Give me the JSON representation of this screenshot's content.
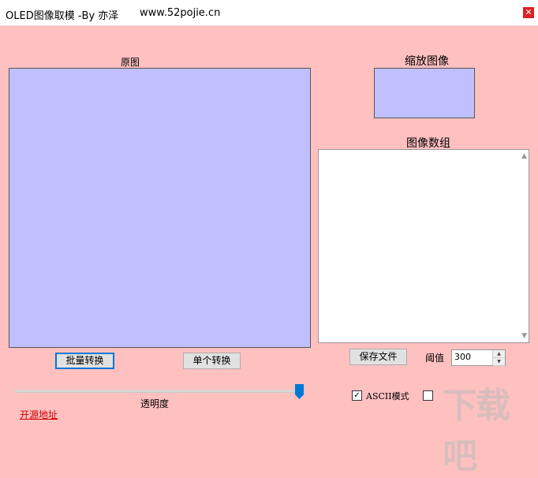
{
  "window": {
    "title": "OLED图像取模   -By 亦泽",
    "site": "www.52pojie.cn",
    "close_glyph": "✕"
  },
  "labels": {
    "original": "原图",
    "scaled": "缩放图像",
    "array": "图像数组",
    "transparency": "透明度",
    "threshold": "阈值"
  },
  "buttons": {
    "batch": "批量转换",
    "single": "单个转换",
    "save": "保存文件"
  },
  "threshold": {
    "value": "300"
  },
  "slider": {
    "value_fraction": 0.98
  },
  "ascii": {
    "label": "ASCII模式",
    "checked": true,
    "mark": "✓"
  },
  "link": {
    "text": "开源地址"
  },
  "watermark": "下载吧",
  "colors": {
    "background": "#ffc0c0",
    "panel": "#c0c0ff",
    "link": "#cc0000",
    "slider_thumb": "#0078d7"
  }
}
